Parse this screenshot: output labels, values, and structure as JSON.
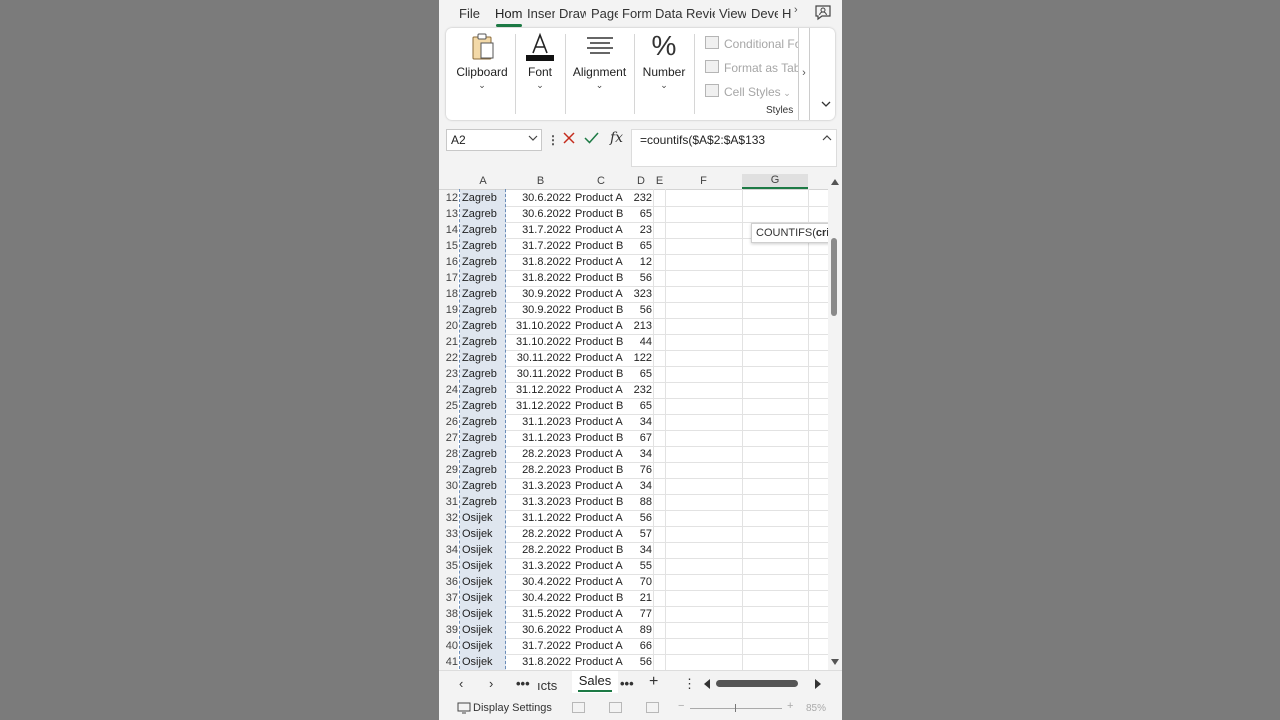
{
  "tabs": [
    "File",
    "Hom",
    "Inser",
    "Draw",
    "Page",
    "Form",
    "Data",
    "Revie",
    "View",
    "Deve",
    "H"
  ],
  "active_tab": "Hom",
  "ribbon": {
    "clipboard": "Clipboard",
    "font": "Font",
    "alignment": "Alignment",
    "number": "Number",
    "conditional": "Conditional For",
    "format_table": "Format as Table",
    "cell_styles": "Cell Styles",
    "styles_label": "Styles"
  },
  "namebox": "A2",
  "formula": "=countifs($A$2:$A$133",
  "columns": [
    "A",
    "B",
    "C",
    "D",
    "E",
    "F",
    "G"
  ],
  "selected_column": "G",
  "tooltip": {
    "prefix": "COUNTIFS(",
    "bold": "criteri"
  },
  "rows": [
    {
      "n": "12",
      "a": "Zagreb",
      "b": "30.6.2022",
      "c": "Product A",
      "d": "232"
    },
    {
      "n": "13",
      "a": "Zagreb",
      "b": "30.6.2022",
      "c": "Product B",
      "d": "65"
    },
    {
      "n": "14",
      "a": "Zagreb",
      "b": "31.7.2022",
      "c": "Product A",
      "d": "23"
    },
    {
      "n": "15",
      "a": "Zagreb",
      "b": "31.7.2022",
      "c": "Product B",
      "d": "65"
    },
    {
      "n": "16",
      "a": "Zagreb",
      "b": "31.8.2022",
      "c": "Product A",
      "d": "12"
    },
    {
      "n": "17",
      "a": "Zagreb",
      "b": "31.8.2022",
      "c": "Product B",
      "d": "56"
    },
    {
      "n": "18",
      "a": "Zagreb",
      "b": "30.9.2022",
      "c": "Product A",
      "d": "323"
    },
    {
      "n": "19",
      "a": "Zagreb",
      "b": "30.9.2022",
      "c": "Product B",
      "d": "56"
    },
    {
      "n": "20",
      "a": "Zagreb",
      "b": "31.10.2022",
      "c": "Product A",
      "d": "213"
    },
    {
      "n": "21",
      "a": "Zagreb",
      "b": "31.10.2022",
      "c": "Product B",
      "d": "44"
    },
    {
      "n": "22",
      "a": "Zagreb",
      "b": "30.11.2022",
      "c": "Product A",
      "d": "122"
    },
    {
      "n": "23",
      "a": "Zagreb",
      "b": "30.11.2022",
      "c": "Product B",
      "d": "65"
    },
    {
      "n": "24",
      "a": "Zagreb",
      "b": "31.12.2022",
      "c": "Product A",
      "d": "232"
    },
    {
      "n": "25",
      "a": "Zagreb",
      "b": "31.12.2022",
      "c": "Product B",
      "d": "65"
    },
    {
      "n": "26",
      "a": "Zagreb",
      "b": "31.1.2023",
      "c": "Product A",
      "d": "34"
    },
    {
      "n": "27",
      "a": "Zagreb",
      "b": "31.1.2023",
      "c": "Product B",
      "d": "67"
    },
    {
      "n": "28",
      "a": "Zagreb",
      "b": "28.2.2023",
      "c": "Product A",
      "d": "34"
    },
    {
      "n": "29",
      "a": "Zagreb",
      "b": "28.2.2023",
      "c": "Product B",
      "d": "76"
    },
    {
      "n": "30",
      "a": "Zagreb",
      "b": "31.3.2023",
      "c": "Product A",
      "d": "34"
    },
    {
      "n": "31",
      "a": "Zagreb",
      "b": "31.3.2023",
      "c": "Product B",
      "d": "88"
    },
    {
      "n": "32",
      "a": "Osijek",
      "b": "31.1.2022",
      "c": "Product A",
      "d": "56"
    },
    {
      "n": "33",
      "a": "Osijek",
      "b": "28.2.2022",
      "c": "Product A",
      "d": "57"
    },
    {
      "n": "34",
      "a": "Osijek",
      "b": "28.2.2022",
      "c": "Product B",
      "d": "34"
    },
    {
      "n": "35",
      "a": "Osijek",
      "b": "31.3.2022",
      "c": "Product A",
      "d": "55"
    },
    {
      "n": "36",
      "a": "Osijek",
      "b": "30.4.2022",
      "c": "Product A",
      "d": "70"
    },
    {
      "n": "37",
      "a": "Osijek",
      "b": "30.4.2022",
      "c": "Product B",
      "d": "21"
    },
    {
      "n": "38",
      "a": "Osijek",
      "b": "31.5.2022",
      "c": "Product A",
      "d": "77"
    },
    {
      "n": "39",
      "a": "Osijek",
      "b": "30.6.2022",
      "c": "Product A",
      "d": "89"
    },
    {
      "n": "40",
      "a": "Osijek",
      "b": "31.7.2022",
      "c": "Product A",
      "d": "66"
    },
    {
      "n": "41",
      "a": "Osijek",
      "b": "31.8.2022",
      "c": "Product A",
      "d": "56"
    }
  ],
  "sheets": {
    "partial": "ıcts",
    "active": "Sales"
  },
  "status": {
    "display_settings": "Display Settings",
    "zoom": "85%"
  },
  "colors": {
    "accent": "#1d7a45",
    "selection": "#dfe6ef"
  }
}
